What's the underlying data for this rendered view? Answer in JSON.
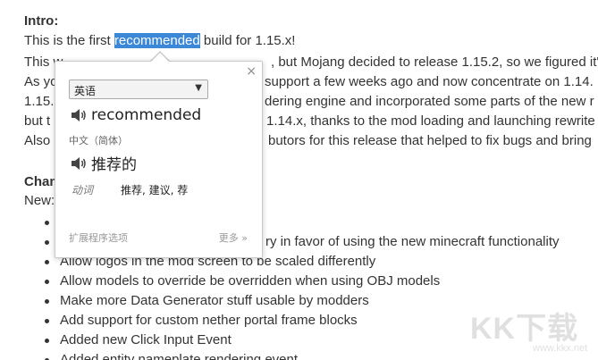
{
  "article": {
    "intro_heading": "Intro:",
    "line1_before": "This is the first ",
    "line1_selected": "recommended",
    "line1_after": " build for 1.15.x!",
    "line2_start": "This w",
    "line2_end": ", but Mojang decided to release 1.15.2, so we figured it'",
    "line3_start": "As yo",
    "line3_end": "support a few weeks ago and now concentrate on 1.14.",
    "line4_start": "1.15.",
    "line4_end": "dering engine and incorporated some parts of the new r",
    "line5_start": "but t",
    "line5_end": "1.14.x, thanks to the mod loading and launching rewrite",
    "line6_start": "Also",
    "line6_end": "butors for this release that helped to fix bugs and bring",
    "changes_heading": "Chan",
    "new_label": "New:",
    "changes": [
      "e",
      "ry in favor of using the new minecraft functionality",
      "Allow logos in the mod screen to be scaled differently",
      "Allow models to override be overridden when using OBJ models",
      "Make more Data Generator stuff usable by modders",
      "Add support for custom nether portal frame blocks",
      "Added new Click Input Event",
      "Added entity nameplate rendering event"
    ]
  },
  "popup": {
    "close_glyph": "×",
    "source_language": "英语",
    "word": "recommended",
    "target_language": "中文（简体）",
    "translation": "推荐的",
    "part_of_speech": "动词",
    "pos_terms": "推荐, 建议, 荐",
    "extension_options": "扩展程序选项",
    "more": "更多 »"
  },
  "watermark": {
    "logo": "KK下载",
    "url": "www.kkx.net"
  },
  "icons": {
    "speaker": "speaker-icon",
    "close": "close-icon",
    "dropdown": "chevron-down-icon"
  }
}
